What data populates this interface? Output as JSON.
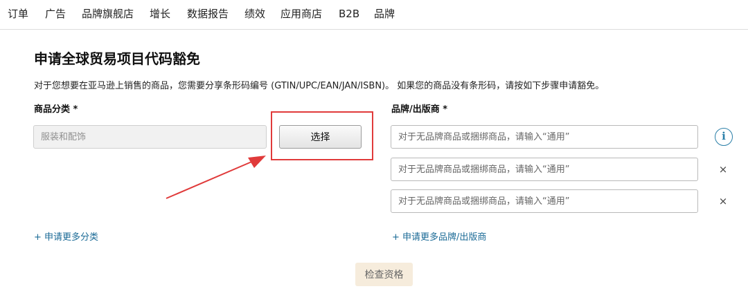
{
  "nav": {
    "items": [
      {
        "label": "订单"
      },
      {
        "label": "广告"
      },
      {
        "label": "品牌旗舰店"
      },
      {
        "label": "增长"
      },
      {
        "label": "数据报告"
      },
      {
        "label": "绩效"
      },
      {
        "label": "应用商店"
      },
      {
        "label": "B2B"
      },
      {
        "label": "品牌"
      }
    ]
  },
  "page": {
    "title": "申请全球贸易项目代码豁免",
    "description": "对于您想要在亚马逊上销售的商品，您需要分享条形码编号 (GTIN/UPC/EAN/JAN/ISBN)。 如果您的商品没有条形码，请按如下步骤申请豁免。"
  },
  "category": {
    "label": "商品分类 *",
    "placeholder": "服装和配饰",
    "select_label": "选择",
    "add_more": "+ 申请更多分类"
  },
  "brand": {
    "label": "品牌/出版商 *",
    "inputs": [
      {
        "placeholder": "对于无品牌商品或捆绑商品，请输入“通用”"
      },
      {
        "placeholder": "对于无品牌商品或捆绑商品，请输入“通用”"
      },
      {
        "placeholder": "对于无品牌商品或捆绑商品，请输入“通用”"
      }
    ],
    "info_icon": "i",
    "remove_icon": "×",
    "add_more": "+ 申请更多品牌/出版商"
  },
  "actions": {
    "check_label": "检查资格"
  },
  "colors": {
    "annotation": "#e03a3a",
    "link": "#1a6a96",
    "check_button_bg": "#f6ecdc"
  }
}
